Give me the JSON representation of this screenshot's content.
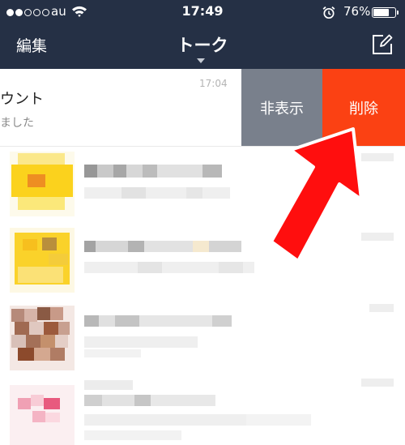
{
  "status_bar": {
    "carrier": "au",
    "time": "17:49",
    "battery_percent": "76%",
    "battery_level": 0.76,
    "signal_bars": 2,
    "signal_total": 5
  },
  "nav": {
    "left_label": "編集",
    "title": "トーク",
    "right_icon": "compose-icon"
  },
  "swiped_row": {
    "name": "ウント",
    "preview": "ました",
    "time": "17:04",
    "hide_label": "非表示",
    "delete_label": "削除"
  },
  "colors": {
    "header": "#253045",
    "hide_button": "#79808c",
    "delete_button": "#fb4113",
    "arrow": "#ff0e0e"
  },
  "annotation": {
    "icon": "red-arrow-icon"
  },
  "chats": [
    {
      "avatar": "blurred-avatar-yellow"
    },
    {
      "avatar": "blurred-avatar-yellow"
    },
    {
      "avatar": "blurred-avatar-brown"
    },
    {
      "avatar": "blurred-avatar-pink"
    }
  ]
}
